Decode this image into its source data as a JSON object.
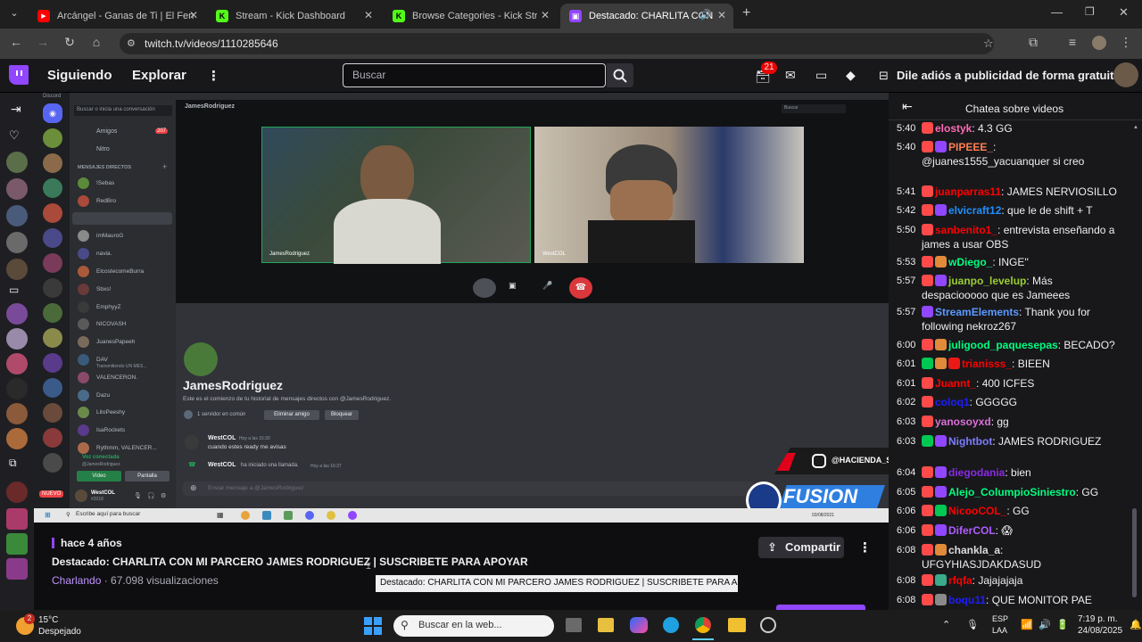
{
  "browser": {
    "tabs": [
      {
        "title": "Arcángel - Ganas de Ti | El Fen",
        "color": "#ff0000",
        "glyph": "▶"
      },
      {
        "title": "Stream - Kick Dashboard",
        "color": "#53fc18",
        "glyph": "K"
      },
      {
        "title": "Browse Categories - Kick Stream",
        "color": "#53fc18",
        "glyph": "K"
      },
      {
        "title": "Destacado: CHARLITA CON",
        "color": "#9146ff",
        "glyph": "▣"
      }
    ],
    "url": "twitch.tv/videos/1110285646"
  },
  "twitch": {
    "following": "Siguiendo",
    "explore": "Explorar",
    "more": "⋮",
    "search_placeholder": "Buscar",
    "notif_count": "21",
    "promo": "Dile adiós a publicidad de forma gratuita"
  },
  "discord": {
    "app_label": "Discord",
    "search": "Buscar o inicia una conversación",
    "friends": "Amigos",
    "friends_count": "207",
    "nitro": "Nitro",
    "dm_header": "MENSAJES DIRECTOS",
    "dms": [
      "!Sebas",
      "RedBro",
      "JamesRodriguez",
      "imMauroG",
      "navia.",
      "ElcostecomeBurra",
      "Sbxs!",
      "EmphyyZ",
      "NICOVASH",
      "JuanesPapeeh",
      "DAV",
      "VALENCERON.",
      "Dazu",
      "LitoPeeshy",
      "IsaRockets",
      "Rythmm, VALENCER..."
    ],
    "dav_sub": "Transmitiendo UN MES...",
    "voice_status": "Voz conectada",
    "voice_user": "@JamesRodriguez",
    "video_btn": "Video",
    "screen_btn": "Pantalla",
    "me_name": "WestCOL",
    "me_tag": "#2018",
    "call_header": "JamesRodriguez",
    "call_search": "Buscar",
    "tile1": "JamesRodriguez",
    "tile2": "WestCOL",
    "profile_name": "JamesRodriguez",
    "profile_desc": "Este es el comienzo de tu historial de mensajes directos con @JamesRodriguez.",
    "mutual": "1 servidor en común",
    "remove_friend": "Eliminar amigo",
    "block": "Bloquear",
    "msg1_user": "WestCOL",
    "msg1_time": "Hoy a las 16:30",
    "msg1_text": "cuando estes ready me avisas",
    "msg2_user": "WestCOL",
    "msg2_text": "ha iniciado una llamada.",
    "msg2_time": "Hoy a las 16:37",
    "input_placeholder": "Enviar mensaje a @JamesRodriguez",
    "nuevo": "NUEVO"
  },
  "inner_taskbar": {
    "search": "Escribe aquí para buscar",
    "date": "03/08/2021"
  },
  "overlay": {
    "handle": "@HACIENDA_ST",
    "fusion": "FUSION"
  },
  "video_info": {
    "age": "hace 4 años",
    "title": "Destacado: CHARLITA CON MI PARCERO JAMES RODRIGUEZ | SUSCRIBETE PARA APOYAR",
    "channel": "Charlando",
    "views": "67.098 visualizaciones",
    "share": "Compartir",
    "tooltip": "Destacado: CHARLITA CON MI PARCERO JAMES RODRIGUEZ | SUSCRIBETE PARA APOYAR"
  },
  "chat": {
    "header": "Chatea sobre videos",
    "messages": [
      {
        "t": "5:40",
        "user": "elostyk",
        "color": "#ff69b4",
        "text": "4.3 GG"
      },
      {
        "t": "5:40",
        "user": "PIPEEE_",
        "color": "#ff7f50",
        "text": "@juanes1555_yacuanquer si creo"
      },
      {
        "t": "5:41",
        "user": "juanparras11",
        "color": "#ff0000",
        "text": "JAMES NERVIOSILLO"
      },
      {
        "t": "5:42",
        "user": "elvicraft12",
        "color": "#1e90ff",
        "text": "que le de shift + T"
      },
      {
        "t": "5:50",
        "user": "sanbenito1_",
        "color": "#ff0000",
        "text": "entrevista enseñando a james a usar OBS"
      },
      {
        "t": "5:53",
        "user": "wDiego_",
        "color": "#00ff7f",
        "text": "INGE''"
      },
      {
        "t": "5:57",
        "user": "juanpo_levelup",
        "color": "#9acd32",
        "text": "Más despaciooooo que es Jameees"
      },
      {
        "t": "5:57",
        "user": "StreamElements",
        "color": "#5b99ff",
        "text": "Thank you for following nekroz267"
      },
      {
        "t": "6:00",
        "user": "juligood_paquesepas",
        "color": "#00ff7f",
        "text": "BECADO?"
      },
      {
        "t": "6:01",
        "user": "trianisss_",
        "color": "#ff0000",
        "text": "BIEEN"
      },
      {
        "t": "6:01",
        "user": "Juannt_",
        "color": "#ff0000",
        "text": "400 ICFES"
      },
      {
        "t": "6:02",
        "user": "coloq1",
        "color": "#1e1eff",
        "text": "GGGGG"
      },
      {
        "t": "6:03",
        "user": "yanosoyxd",
        "color": "#da70d6",
        "text": "gg"
      },
      {
        "t": "6:03",
        "user": "Nightbot",
        "color": "#7c7cff",
        "text": "JAMES RODRIGUEZ"
      },
      {
        "t": "6:04",
        "user": "diegodania",
        "color": "#8a2be2",
        "text": "bien"
      },
      {
        "t": "6:05",
        "user": "Alejo_ColumpioSiniestro",
        "color": "#00ff7f",
        "text": "GG"
      },
      {
        "t": "6:06",
        "user": "NicooCOL_",
        "color": "#ff0000",
        "text": "GG"
      },
      {
        "t": "6:06",
        "user": "DiferCOL",
        "color": "#b05cff",
        "text": "😱"
      },
      {
        "t": "6:08",
        "user": "chankla_a",
        "color": "#dcdcdc",
        "text": "UFGYHIASJDAKDASUD"
      },
      {
        "t": "6:08",
        "user": "rfqfa",
        "color": "#ff0000",
        "text": "Jajajajaja"
      },
      {
        "t": "6:08",
        "user": "boqu11",
        "color": "#1e1eff",
        "text": "QUE MONITOR PAE"
      }
    ]
  },
  "taskbar": {
    "temp": "15°C",
    "weather": "Despejado",
    "weather_badge": "2",
    "search": "Buscar en la web...",
    "lang1": "ESP",
    "lang2": "LAA",
    "time": "7:19 p. m.",
    "date": "24/08/2025"
  }
}
